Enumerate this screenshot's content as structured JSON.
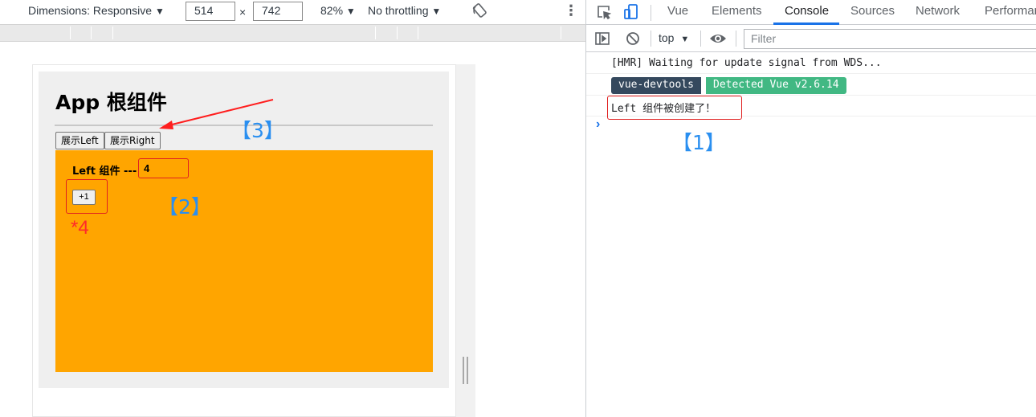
{
  "devicebar": {
    "dimensions_label": "Dimensions: Responsive",
    "width_value": "514",
    "times": "×",
    "height_value": "742",
    "zoom": "82%",
    "throttling": "No throttling",
    "dropdown_glyph": "▼",
    "more_glyph": "⋮"
  },
  "app": {
    "title": "App 根组件",
    "buttons": [
      "展示Left",
      "展示Right"
    ],
    "left": {
      "title": "Left 组件 ---",
      "count": "4",
      "increment_label": "+1"
    }
  },
  "annotations": {
    "label1": "【1】",
    "label2": "【2】",
    "label3": "【3】",
    "star": "*4",
    "annotation_color": "#e02020",
    "label_color": "#2a8ff0"
  },
  "devtools": {
    "tabs": [
      "Vue",
      "Elements",
      "Console",
      "Sources",
      "Network",
      "Performar"
    ],
    "active_tab": "Console",
    "context": "top",
    "filter_placeholder": "Filter",
    "console": [
      "[HMR] Waiting for update signal from WDS...",
      "Left 组件被创建了！"
    ],
    "badge_left": "vue-devtools",
    "badge_right": "Detected Vue v2.6.14",
    "prompt_glyph": "›"
  },
  "colors": {
    "left_bg": "#ffa500",
    "app_bg": "#efefef",
    "vue_dark": "#35495e",
    "vue_green": "#41b883",
    "active_tab": "#1a73e8"
  }
}
